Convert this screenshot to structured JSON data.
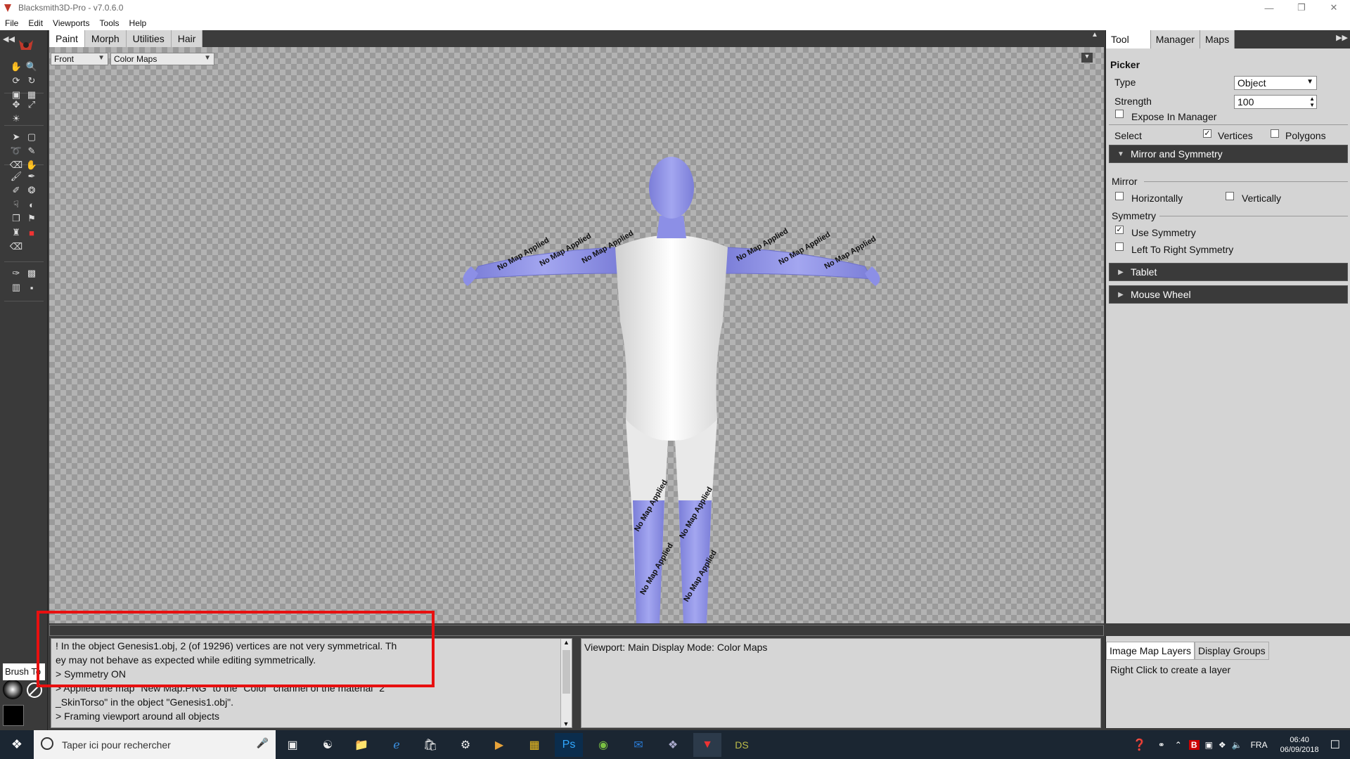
{
  "window": {
    "title": "Blacksmith3D-Pro - v7.0.6.0"
  },
  "menu": [
    "File",
    "Edit",
    "Viewports",
    "Tools",
    "Help"
  ],
  "mode_tabs": [
    "Paint",
    "Morph",
    "Utilities",
    "Hair"
  ],
  "viewport": {
    "view_select": "Front",
    "map_select": "Color Maps",
    "texture_label": "No Map Applied"
  },
  "right_tabs": [
    "Tool",
    "Manager",
    "Maps"
  ],
  "picker": {
    "header": "Picker",
    "type_label": "Type",
    "type_value": "Object",
    "strength_label": "Strength",
    "strength_value": "100",
    "expose_label": "Expose In Manager",
    "select_label": "Select",
    "vertices_label": "Vertices",
    "polygons_label": "Polygons",
    "vertices_checked": true,
    "polygons_checked": false,
    "expose_checked": false
  },
  "sections": {
    "mirror_sym": "Mirror and Symmetry",
    "mirror_group": "Mirror",
    "horizontally": "Horizontally",
    "vertically": "Vertically",
    "symmetry_group": "Symmetry",
    "use_symmetry": "Use Symmetry",
    "ltr_symmetry": "Left To Right Symmetry",
    "use_symmetry_checked": true,
    "tablet": "Tablet",
    "mouse_wheel": "Mouse Wheel"
  },
  "log": {
    "lines": [
      "! In the object Genesis1.obj, 2 (of 19296) vertices are not very symmetrical. Th",
      "ey may not behave as expected while editing symmetrically.",
      "> Symmetry ON",
      "> Applied the map \"New Map.PNG\" to the \"Color\" channel of the material \"2",
      "_SkinTorso\" in the object \"Genesis1.obj\".",
      "> Framing viewport around all objects"
    ]
  },
  "status": {
    "text": "Viewport: Main Display Mode: Color Maps"
  },
  "layers": {
    "tabs": [
      "Image Map Layers",
      "Display Groups"
    ],
    "hint": "Right Click to create a layer"
  },
  "brush_tool_label": "Brush To",
  "taskbar": {
    "search_placeholder": "Taper ici pour rechercher",
    "lang": "FRA",
    "time": "06:40",
    "date": "06/09/2018"
  },
  "colors": {
    "highlight": "#e81010",
    "skin_blue": "#8c8fe6",
    "panel_dark": "#3a3a3a"
  }
}
